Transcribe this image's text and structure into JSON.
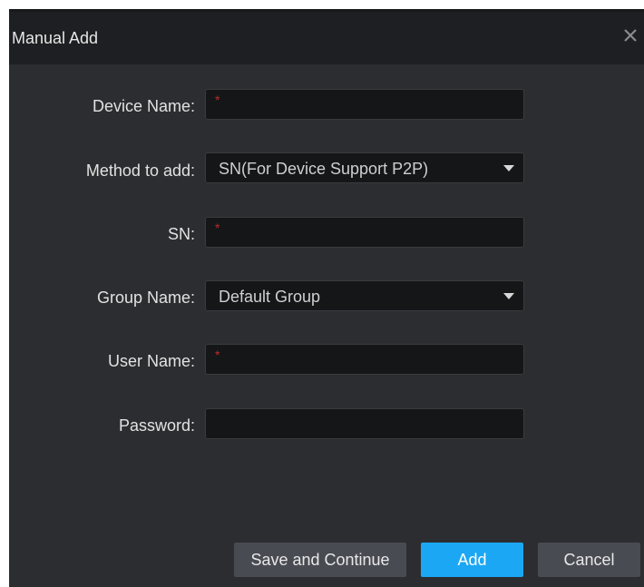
{
  "dialog": {
    "title": "Manual Add",
    "close_icon": "close-icon",
    "colors": {
      "background": "#2c2d31",
      "titlebar": "#1e1f22",
      "input": "#151618",
      "required_marker": "#c0292a",
      "primary_button": "#1ba7f4",
      "secondary_button": "#494b52"
    }
  },
  "form": {
    "device_name": {
      "label": "Device Name:",
      "value": "",
      "required_marker": "*"
    },
    "method": {
      "label": "Method to add:",
      "value": "SN(For Device Support P2P)"
    },
    "sn": {
      "label": "SN:",
      "value": "",
      "required_marker": "*"
    },
    "group": {
      "label": "Group Name:",
      "value": "Default Group"
    },
    "user_name": {
      "label": "User Name:",
      "value": "",
      "required_marker": "*"
    },
    "password": {
      "label": "Password:",
      "value": ""
    }
  },
  "buttons": {
    "save_continue": "Save and Continue",
    "add": "Add",
    "cancel": "Cancel"
  }
}
